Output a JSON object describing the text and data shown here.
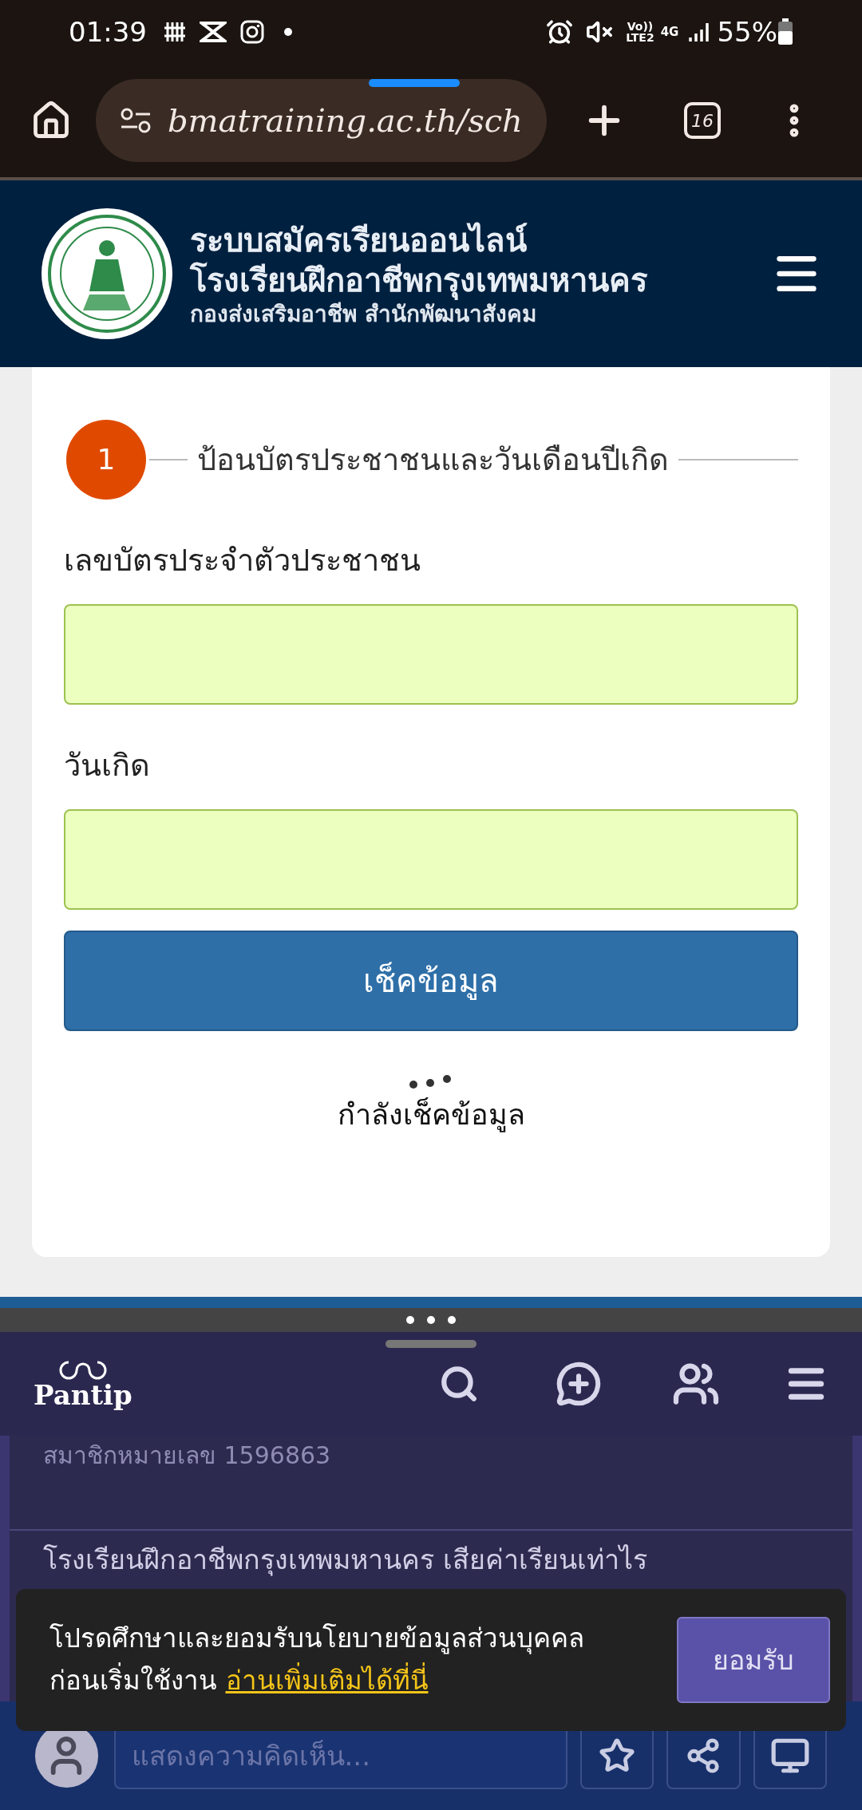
{
  "status_bar": {
    "time": "01:39",
    "volte": "Vo))",
    "lte": "LTE2",
    "network": "4G",
    "battery": "55%"
  },
  "browser": {
    "url": "bmatraining.ac.th/sch",
    "tab_count": "16"
  },
  "site_header": {
    "title": "ระบบสมัครเรียนออนไลน์",
    "subtitle": "โรงเรียนฝึกอาชีพกรุงเทพมหานคร",
    "department": "กองส่งเสริมอาชีพ สำนักพัฒนาสังคม"
  },
  "form": {
    "step_number": "1",
    "step_title": "ป้อนบัตรประชาชนและวันเดือนปีเกิด",
    "fields": [
      {
        "label": "เลขบัตรประจำตัวประชาชน"
      },
      {
        "label": "วันเกิด"
      }
    ],
    "button": "เช็คข้อมูล",
    "loading_text": "กำลังเช็คข้อมูล"
  },
  "pantip": {
    "logo": "Pantip",
    "member": "สมาชิกหมายเลข 1596863",
    "topic_title": "โรงเรียนฝึกอาชีพกรุงเทพมหานคร เสียค่าเรียนเท่าไร",
    "cookie": {
      "text": "โปรดศึกษาและยอมรับนโยบายข้อมูลส่วนบุคคล ก่อนเริ่มใช้งาน",
      "link": "อ่านเพิ่มเติมได้ที่นี่",
      "accept": "ยอมรับ"
    },
    "comment_placeholder": "แสดงความคิดเห็น..."
  }
}
